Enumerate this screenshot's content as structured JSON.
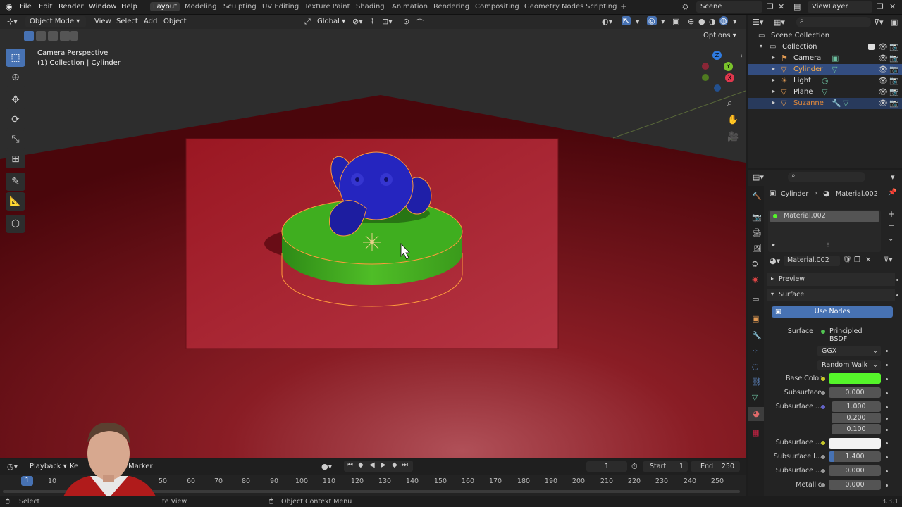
{
  "app": {
    "menu": [
      "File",
      "Edit",
      "Render",
      "Window",
      "Help"
    ],
    "workspaces": [
      "Layout",
      "Modeling",
      "Sculpting",
      "UV Editing",
      "Texture Paint",
      "Shading",
      "Animation",
      "Rendering",
      "Compositing",
      "Geometry Nodes",
      "Scripting"
    ],
    "active_workspace": "Layout",
    "add_workspace": "+",
    "scene": "Scene",
    "view_layer": "ViewLayer"
  },
  "viewport_header": {
    "mode": "Object Mode",
    "menus": [
      "View",
      "Select",
      "Add",
      "Object"
    ],
    "orientation": "Global",
    "options": "Options"
  },
  "viewport": {
    "camera_label": "Camera Perspective",
    "collection_label": "(1) Collection | Cylinder",
    "gizmo_axes": [
      "X",
      "Y",
      "Z"
    ],
    "object_colors": {
      "floor": "#7a0f17",
      "suzanne": "#2222bb",
      "cylinder": "#3fae1f",
      "selection_outline": "#ff9a3c"
    }
  },
  "outliner": {
    "root": "Scene Collection",
    "collection": "Collection",
    "items": [
      {
        "name": "Camera",
        "selected": false,
        "active": false
      },
      {
        "name": "Cylinder",
        "selected": true,
        "active": true
      },
      {
        "name": "Light",
        "selected": false,
        "active": false
      },
      {
        "name": "Plane",
        "selected": false,
        "active": false
      },
      {
        "name": "Suzanne",
        "selected": true,
        "active": false
      }
    ]
  },
  "properties": {
    "breadcrumb_object": "Cylinder",
    "breadcrumb_material": "Material.002",
    "slot_name": "Material.002",
    "material_name": "Material.002",
    "preview_label": "Preview",
    "surface_panel": "Surface",
    "use_nodes": "Use Nodes",
    "surface_label": "Surface",
    "surface_shader": "Principled BSDF",
    "distribution": "GGX",
    "subsurface_method": "Random Walk",
    "rows": [
      {
        "label": "Base Color",
        "value": "",
        "kind": "color",
        "color": "#55f52a"
      },
      {
        "label": "Subsurface",
        "value": "0.000",
        "kind": "num"
      },
      {
        "label": "Subsurface ...",
        "value": "1.000",
        "kind": "num"
      },
      {
        "label": "",
        "value": "0.200",
        "kind": "num"
      },
      {
        "label": "",
        "value": "0.100",
        "kind": "num"
      },
      {
        "label": "Subsurface ...",
        "value": "",
        "kind": "color",
        "color": "#f2f2f2"
      },
      {
        "label": "Subsurface I...",
        "value": "1.400",
        "kind": "num"
      },
      {
        "label": "Subsurface ...",
        "value": "0.000",
        "kind": "num"
      },
      {
        "label": "Metallic",
        "value": "0.000",
        "kind": "num"
      }
    ]
  },
  "timeline": {
    "menus": [
      "Playback",
      "Ke",
      "Marker"
    ],
    "current_frame": "1",
    "start_label": "Start",
    "start": "1",
    "end_label": "End",
    "end": "250",
    "playhead": "1",
    "ticks": [
      "10",
      "50",
      "60",
      "70",
      "80",
      "90",
      "100",
      "110",
      "120",
      "130",
      "140",
      "150",
      "160",
      "170",
      "180",
      "190",
      "200",
      "210",
      "220",
      "230",
      "240",
      "250"
    ]
  },
  "status": {
    "left": "Select",
    "middle_partial": "te View",
    "context": "Object Context Menu",
    "version": "3.3.1"
  }
}
